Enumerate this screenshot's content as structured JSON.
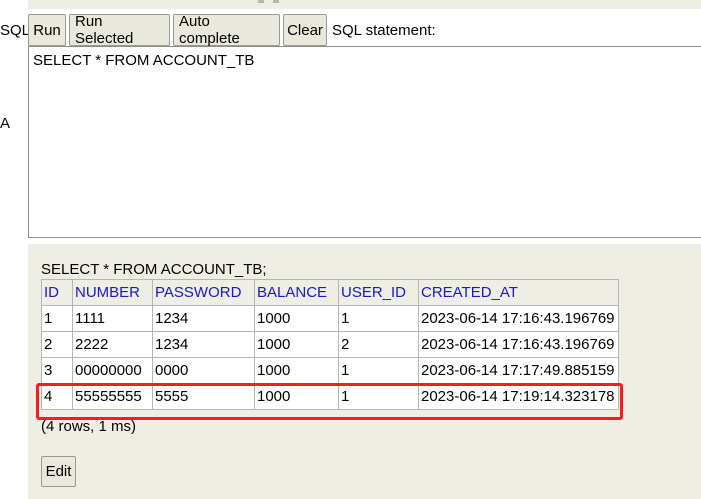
{
  "sidebar": {
    "label_sql": "SQL",
    "label_a": "A"
  },
  "toolbar": {
    "run_label": "Run",
    "run_selected_label": "Run Selected",
    "auto_complete_label": "Auto complete",
    "clear_label": "Clear",
    "sql_statement_label": "SQL statement:"
  },
  "editor": {
    "query": "SELECT * FROM ACCOUNT_TB"
  },
  "result": {
    "query_echo": "SELECT * FROM ACCOUNT_TB;",
    "columns": [
      "ID",
      "NUMBER",
      "PASSWORD",
      "BALANCE",
      "USER_ID",
      "CREATED_AT"
    ],
    "rows": [
      [
        "1",
        "1111",
        "1234",
        "1000",
        "1",
        "2023-06-14 17:16:43.196769"
      ],
      [
        "2",
        "2222",
        "1234",
        "1000",
        "2",
        "2023-06-14 17:16:43.196769"
      ],
      [
        "3",
        "00000000",
        "0000",
        "1000",
        "1",
        "2023-06-14 17:17:49.885159"
      ],
      [
        "4",
        "55555555",
        "5555",
        "1000",
        "1",
        "2023-06-14 17:19:14.323178"
      ]
    ],
    "row_count_text": "(4 rows, 1 ms)",
    "edit_label": "Edit"
  },
  "annotation": {
    "highlight_color": "#ff1a1a",
    "highlighted_row_index": 3
  },
  "colors": {
    "panel_bg": "#efeee4",
    "header_text": "#1818cc",
    "button_bg": "#e9e8dc"
  }
}
